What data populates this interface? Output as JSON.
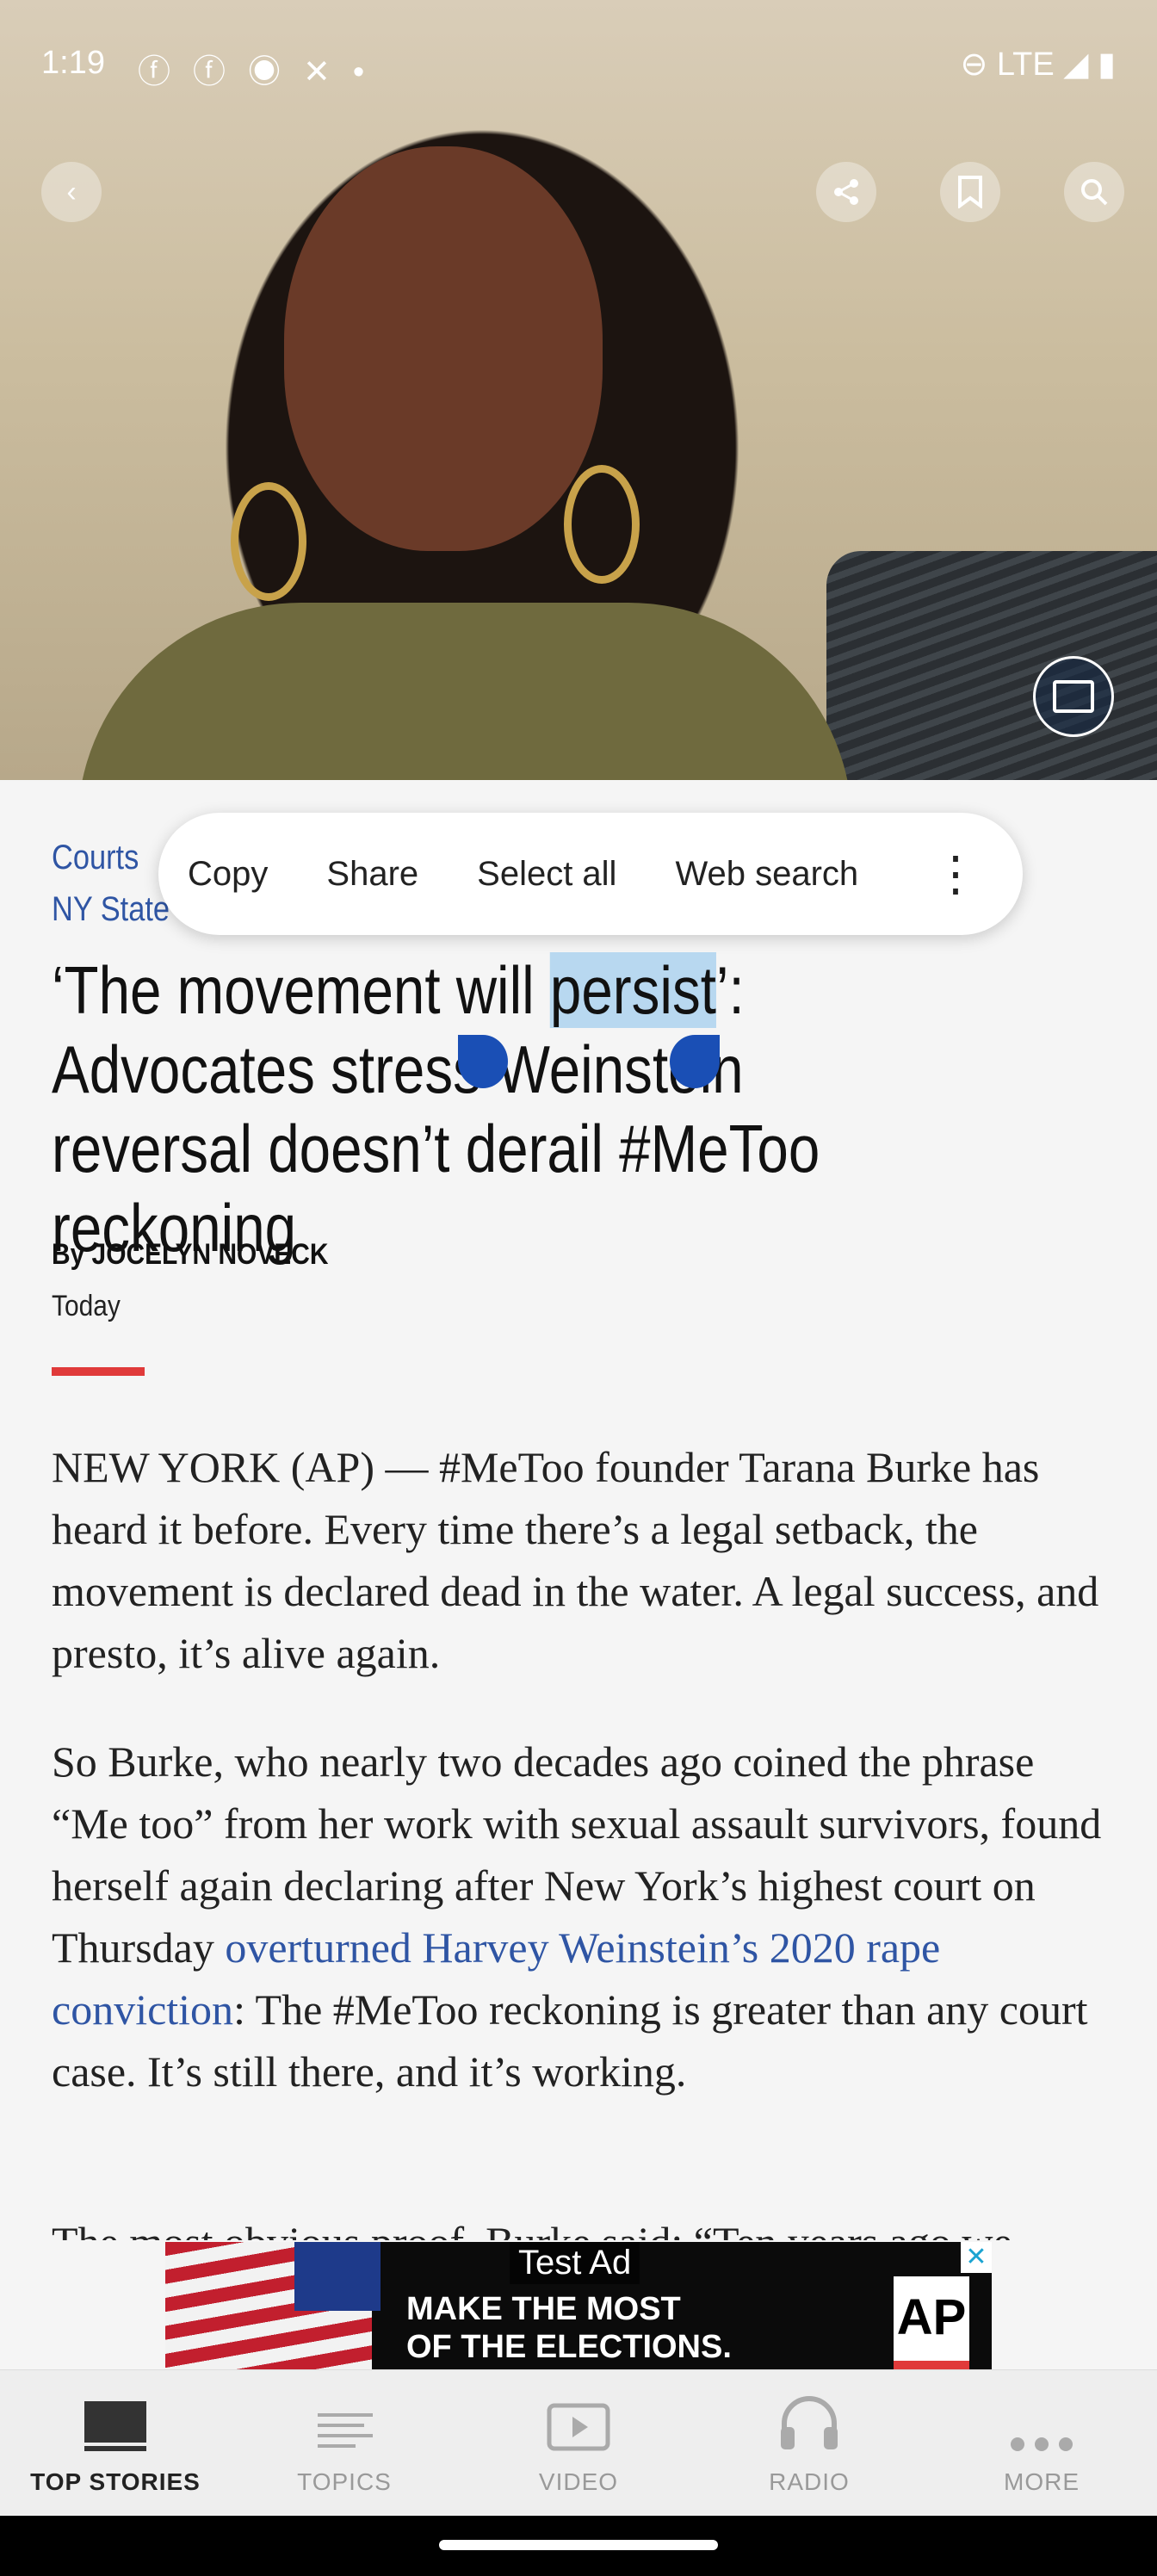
{
  "status_bar": {
    "time": "1:19",
    "network": "LTE"
  },
  "toolbar": {
    "back": "back",
    "share": "share",
    "bookmark": "bookmark",
    "search": "search"
  },
  "article": {
    "topics": [
      "Courts",
      "NY State"
    ],
    "headline_before": "‘The movement will ",
    "headline_selected": "persist",
    "headline_after": "’: Advocates stress Weinstein reversal doesn’t derail #MeToo reckoning",
    "byline": "By JOCELYN NOVECK",
    "date": "Today",
    "p1": "NEW YORK (AP) — #MeToo founder Tarana Burke has heard it before. Every time there’s a legal setback, the movement is declared dead in the water. A legal success, and presto, it’s alive again.",
    "p2_before": "So Burke, who nearly two decades ago coined the phrase “Me too” from her work with sexual assault survivors, found herself again declaring after New York’s highest court on Thursday ",
    "p2_link": "overturned Harvey Weinstein’s 2020 rape conviction",
    "p2_after": ": The #MeToo reckoning is greater than any court case. It’s still there, and it’s working.",
    "p3": "The most obvious proof, Burke said: “Ten years ago we"
  },
  "context_menu": {
    "copy": "Copy",
    "share": "Share",
    "select_all": "Select all",
    "web_search": "Web search"
  },
  "ad": {
    "label": "Test Ad",
    "line1": "MAKE THE MOST",
    "line2": "OF THE ELECTIONS.",
    "logo": "AP"
  },
  "bottom_nav": [
    "TOP STORIES",
    "TOPICS",
    "VIDEO",
    "RADIO",
    "MORE"
  ]
}
